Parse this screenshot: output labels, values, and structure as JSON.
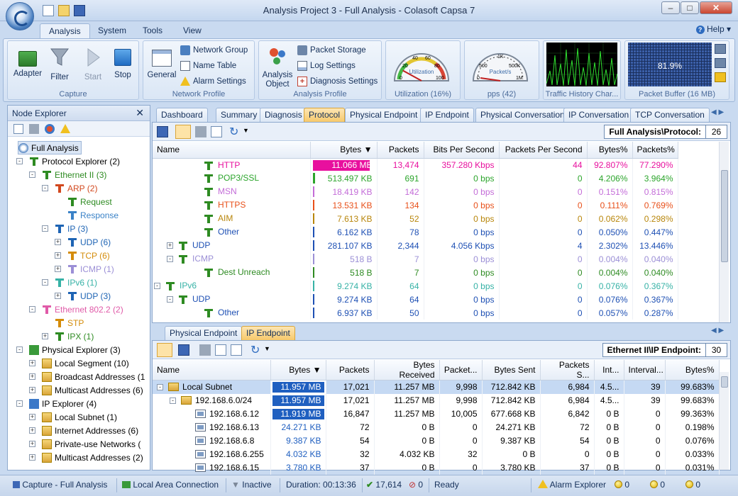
{
  "window": {
    "title": "Analysis Project 3 - Full Analysis - Colasoft Capsa 7"
  },
  "menu": {
    "tabs": [
      "Analysis",
      "System",
      "Tools",
      "View"
    ],
    "help": "Help"
  },
  "ribbon": {
    "capture": {
      "label": "Capture",
      "adapter": "Adapter",
      "filter": "Filter",
      "start": "Start",
      "stop": "Stop"
    },
    "network_profile": {
      "label": "Network Profile",
      "general": "General",
      "network_group": "Network Group",
      "name_table": "Name Table",
      "alarm_settings": "Alarm Settings"
    },
    "analysis_profile": {
      "label": "Analysis Profile",
      "analysis_object_1": "Analysis",
      "analysis_object_2": "Object",
      "packet_storage": "Packet Storage",
      "log_settings": "Log Settings",
      "diagnosis_settings": "Diagnosis Settings"
    },
    "utilization": {
      "label": "Utilization (16%)",
      "gauge_text": "Utilization",
      "scale": [
        "0",
        "20",
        "40",
        "60",
        "80",
        "100"
      ],
      "value_fraction": 0.16
    },
    "pps": {
      "label": "pps (42)",
      "gauge_text": "Packet/s",
      "scale": [
        "0",
        "500",
        "1K",
        "500K",
        "1M"
      ]
    },
    "traffic": {
      "label": "Traffic History Char..."
    },
    "buffer": {
      "label": "Packet Buffer (16 MB)",
      "value": "81.9%",
      "value_fraction": 0.819
    }
  },
  "node_explorer": {
    "title": "Node Explorer",
    "items": [
      {
        "label": "Full Analysis",
        "color": "#000000"
      },
      {
        "label": "Protocol Explorer (2)",
        "color": "#000000"
      },
      {
        "label": "Ethernet II (3)",
        "color": "#2e8b22"
      },
      {
        "label": "ARP (2)",
        "color": "#d2481e"
      },
      {
        "label": "Request",
        "color": "#2e8b22"
      },
      {
        "label": "Response",
        "color": "#3a82c7"
      },
      {
        "label": "IP (3)",
        "color": "#1e64b4"
      },
      {
        "label": "UDP (6)",
        "color": "#1e64b4"
      },
      {
        "label": "TCP (6)",
        "color": "#d48c0a"
      },
      {
        "label": "ICMP (1)",
        "color": "#9b8fd6"
      },
      {
        "label": "IPv6 (1)",
        "color": "#36b2a6"
      },
      {
        "label": "UDP (3)",
        "color": "#1e64b4"
      },
      {
        "label": "Ethernet 802.2 (2)",
        "color": "#e05aa8"
      },
      {
        "label": "STP",
        "color": "#d48c0a"
      },
      {
        "label": "IPX (1)",
        "color": "#2e8b22"
      },
      {
        "label": "Physical Explorer (3)",
        "color": "#000000"
      },
      {
        "label": "Local Segment (10)",
        "color": "#000000"
      },
      {
        "label": "Broadcast Addresses (1",
        "color": "#000000"
      },
      {
        "label": "Multicast Addresses (6)",
        "color": "#000000"
      },
      {
        "label": "IP Explorer (4)",
        "color": "#000000"
      },
      {
        "label": "Local Subnet (1)",
        "color": "#000000"
      },
      {
        "label": "Internet Addresses (6)",
        "color": "#000000"
      },
      {
        "label": "Private-use Networks (",
        "color": "#000000"
      },
      {
        "label": "Multicast Addresses (2)",
        "color": "#000000"
      }
    ]
  },
  "upper_tabs": [
    "Dashboard",
    "Summary",
    "Diagnosis",
    "Protocol",
    "Physical Endpoint",
    "IP Endpoint",
    "Physical Conversation",
    "IP Conversation",
    "TCP Conversation"
  ],
  "protocol_view": {
    "path": "Full Analysis\\Protocol:",
    "count": "26",
    "columns": [
      "Name",
      "Bytes",
      "Packets",
      "Bits Per Second",
      "Packets Per Second",
      "Bytes%",
      "Packets%"
    ],
    "rows": [
      {
        "name": "HTTP",
        "bytes": "11.066 MB",
        "packets": "13,474",
        "bps": "357.280 Kbps",
        "pps": "44",
        "bytes_pct": "92.807%",
        "packets_pct": "77.290%",
        "color": "#e8109e",
        "bar_fraction": 0.93
      },
      {
        "name": "POP3/SSL",
        "bytes": "513.497 KB",
        "packets": "691",
        "bps": "0 bps",
        "pps": "0",
        "bytes_pct": "4.206%",
        "packets_pct": "3.964%",
        "color": "#2ca52c",
        "bar_fraction": 0.04
      },
      {
        "name": "MSN",
        "bytes": "18.419 KB",
        "packets": "142",
        "bps": "0 bps",
        "pps": "0",
        "bytes_pct": "0.151%",
        "packets_pct": "0.815%",
        "color": "#c36cd8",
        "bar_fraction": 0
      },
      {
        "name": "HTTPS",
        "bytes": "13.531 KB",
        "packets": "134",
        "bps": "0 bps",
        "pps": "0",
        "bytes_pct": "0.111%",
        "packets_pct": "0.769%",
        "color": "#e8501a",
        "bar_fraction": 0
      },
      {
        "name": "AIM",
        "bytes": "7.613 KB",
        "packets": "52",
        "bps": "0 bps",
        "pps": "0",
        "bytes_pct": "0.062%",
        "packets_pct": "0.298%",
        "color": "#b8860b",
        "bar_fraction": 0
      },
      {
        "name": "Other",
        "bytes": "6.162 KB",
        "packets": "78",
        "bps": "0 bps",
        "pps": "0",
        "bytes_pct": "0.050%",
        "packets_pct": "0.447%",
        "color": "#1e50b4",
        "bar_fraction": 0
      },
      {
        "name": "UDP",
        "bytes": "281.107 KB",
        "packets": "2,344",
        "bps": "4.056 Kbps",
        "pps": "4",
        "bytes_pct": "2.302%",
        "packets_pct": "13.446%",
        "color": "#1e50b4",
        "bar_fraction": 0.02
      },
      {
        "name": "ICMP",
        "bytes": "518 B",
        "packets": "7",
        "bps": "0 bps",
        "pps": "0",
        "bytes_pct": "0.004%",
        "packets_pct": "0.040%",
        "color": "#9b8fd6",
        "bar_fraction": 0
      },
      {
        "name": "Dest Unreach",
        "bytes": "518 B",
        "packets": "7",
        "bps": "0 bps",
        "pps": "0",
        "bytes_pct": "0.004%",
        "packets_pct": "0.040%",
        "color": "#2e8b22",
        "bar_fraction": 0
      },
      {
        "name": "IPv6",
        "bytes": "9.274 KB",
        "packets": "64",
        "bps": "0 bps",
        "pps": "0",
        "bytes_pct": "0.076%",
        "packets_pct": "0.367%",
        "color": "#36b2a6",
        "bar_fraction": 0
      },
      {
        "name": "UDP",
        "bytes": "9.274 KB",
        "packets": "64",
        "bps": "0 bps",
        "pps": "0",
        "bytes_pct": "0.076%",
        "packets_pct": "0.367%",
        "color": "#1e50b4",
        "bar_fraction": 0
      },
      {
        "name": "Other",
        "bytes": "6.937 KB",
        "packets": "50",
        "bps": "0 bps",
        "pps": "0",
        "bytes_pct": "0.057%",
        "packets_pct": "0.287%",
        "color": "#1e50b4",
        "bar_fraction": 0
      }
    ]
  },
  "lower_tabs": [
    "Physical Endpoint",
    "IP Endpoint"
  ],
  "endpoint_view": {
    "path": "Ethernet II\\IP Endpoint:",
    "count": "30",
    "columns": [
      "Name",
      "Bytes",
      "Packets",
      "Bytes Received",
      "Packet...",
      "Bytes Sent",
      "Packets S...",
      "Int...",
      "Interval...",
      "Bytes%"
    ],
    "rows": [
      {
        "name": "Local Subnet",
        "bytes": "11.957 MB",
        "packets": "17,021",
        "recv": "11.257 MB",
        "precv": "9,998",
        "sent": "712.842 KB",
        "psent": "6,984",
        "int": "4.5...",
        "interval": "39",
        "pct": "99.683%",
        "selected": true,
        "bar": true
      },
      {
        "name": "192.168.6.0/24",
        "bytes": "11.957 MB",
        "packets": "17,021",
        "recv": "11.257 MB",
        "precv": "9,998",
        "sent": "712.842 KB",
        "psent": "6,984",
        "int": "4.5...",
        "interval": "39",
        "pct": "99.683%",
        "selected": false,
        "bar": true
      },
      {
        "name": "192.168.6.12",
        "bytes": "11.919 MB",
        "packets": "16,847",
        "recv": "11.257 MB",
        "precv": "10,005",
        "sent": "677.668 KB",
        "psent": "6,842",
        "int": "0 B",
        "interval": "0",
        "pct": "99.363%",
        "selected": false,
        "bar": true
      },
      {
        "name": "192.168.6.13",
        "bytes": "24.271 KB",
        "packets": "72",
        "recv": "0 B",
        "precv": "0",
        "sent": "24.271 KB",
        "psent": "72",
        "int": "0 B",
        "interval": "0",
        "pct": "0.198%",
        "selected": false,
        "bar": false
      },
      {
        "name": "192.168.6.8",
        "bytes": "9.387 KB",
        "packets": "54",
        "recv": "0 B",
        "precv": "0",
        "sent": "9.387 KB",
        "psent": "54",
        "int": "0 B",
        "interval": "0",
        "pct": "0.076%",
        "selected": false,
        "bar": false
      },
      {
        "name": "192.168.6.255",
        "bytes": "4.032 KB",
        "packets": "32",
        "recv": "4.032 KB",
        "precv": "32",
        "sent": "0 B",
        "psent": "0",
        "int": "0 B",
        "interval": "0",
        "pct": "0.033%",
        "selected": false,
        "bar": false
      },
      {
        "name": "192.168.6.15",
        "bytes": "3.780 KB",
        "packets": "37",
        "recv": "0 B",
        "precv": "0",
        "sent": "3.780 KB",
        "psent": "37",
        "int": "0 B",
        "interval": "0",
        "pct": "0.031%",
        "selected": false,
        "bar": false
      }
    ]
  },
  "status": {
    "capture": "Capture - Full Analysis",
    "adapter": "Local Area Connection",
    "filter": "Inactive",
    "duration": "Duration: 00:13:36",
    "packets": "17,614",
    "dropped": "0",
    "state": "Ready",
    "alarm": "Alarm Explorer",
    "alarm_counts": [
      "0",
      "0",
      "0"
    ]
  }
}
